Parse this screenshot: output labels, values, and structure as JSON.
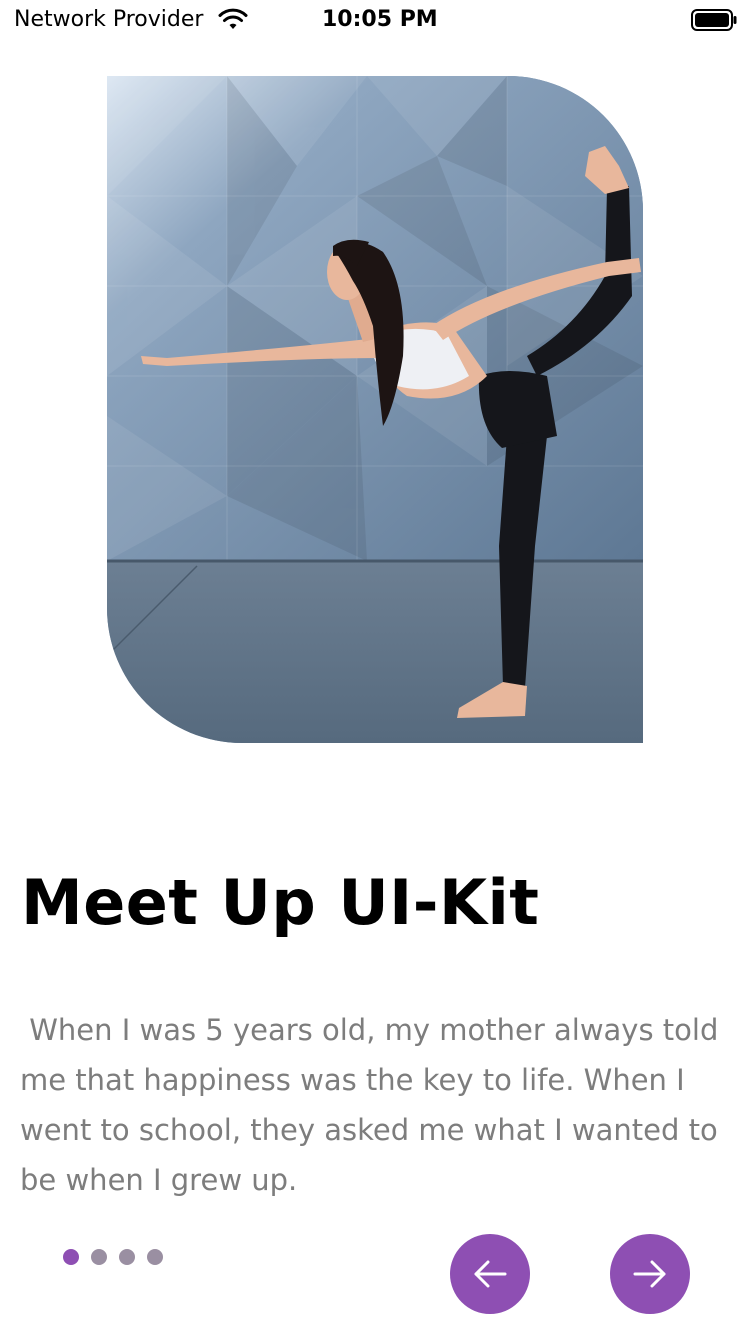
{
  "status_bar": {
    "carrier": "Network Provider",
    "time": "10:05 PM"
  },
  "hero": {
    "image_description": "woman-doing-yoga-standing-bow-pose-icon"
  },
  "content": {
    "title": "Meet Up UI-Kit",
    "body": " When I was 5 years old, my mother always told me that happiness was the key to life. When I went to school, they asked me what I wanted to be when I grew up."
  },
  "pager": {
    "total": 4,
    "active_index": 0
  },
  "navigation": {
    "prev_icon": "arrow-left-icon",
    "next_icon": "arrow-right-icon"
  },
  "colors": {
    "accent": "#8E4FB3",
    "dot_inactive": "#9A8FA2",
    "body_text": "#7D7D7D"
  }
}
